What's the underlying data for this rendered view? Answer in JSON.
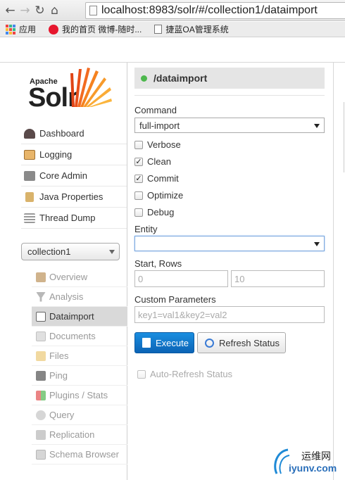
{
  "browser": {
    "url": "localhost:8983/solr/#/collection1/dataimport",
    "bookmarks": [
      "应用",
      "我的首页 微博-随时...",
      "捷蓝OA管理系统"
    ]
  },
  "logo": {
    "apache": "Apache",
    "solr": "Solr"
  },
  "sidebar": {
    "items": [
      {
        "label": "Dashboard",
        "icon": "dashboard-icon"
      },
      {
        "label": "Logging",
        "icon": "logging-icon"
      },
      {
        "label": "Core Admin",
        "icon": "core-admin-icon"
      },
      {
        "label": "Java Properties",
        "icon": "java-properties-icon"
      },
      {
        "label": "Thread Dump",
        "icon": "thread-dump-icon"
      }
    ],
    "core_selector": "collection1",
    "core_menu": [
      {
        "label": "Overview",
        "icon": "overview-icon"
      },
      {
        "label": "Analysis",
        "icon": "analysis-icon"
      },
      {
        "label": "Dataimport",
        "icon": "dataimport-icon",
        "active": true
      },
      {
        "label": "Documents",
        "icon": "documents-icon"
      },
      {
        "label": "Files",
        "icon": "files-icon"
      },
      {
        "label": "Ping",
        "icon": "ping-icon"
      },
      {
        "label": "Plugins / Stats",
        "icon": "plugins-icon"
      },
      {
        "label": "Query",
        "icon": "query-icon"
      },
      {
        "label": "Replication",
        "icon": "replication-icon"
      },
      {
        "label": "Schema Browser",
        "icon": "schema-browser-icon"
      }
    ]
  },
  "main": {
    "handler": "/dataimport",
    "status_color": "#4db84d",
    "command_label": "Command",
    "command_value": "full-import",
    "options": [
      {
        "label": "Verbose",
        "checked": false
      },
      {
        "label": "Clean",
        "checked": true
      },
      {
        "label": "Commit",
        "checked": true
      },
      {
        "label": "Optimize",
        "checked": false
      },
      {
        "label": "Debug",
        "checked": false
      }
    ],
    "entity_label": "Entity",
    "entity_value": "",
    "start_rows_label": "Start, Rows",
    "start_placeholder": "0",
    "rows_placeholder": "10",
    "custom_params_label": "Custom Parameters",
    "custom_params_placeholder": "key1=val1&key2=val2",
    "execute_label": "Execute",
    "refresh_label": "Refresh Status",
    "auto_refresh_label": "Auto-Refresh Status"
  },
  "watermark": {
    "line1": "运维网",
    "line2": "iyunv.com"
  },
  "colors": {
    "execute_button": "#0b63b5",
    "active_menu": "#d9d9d9"
  }
}
